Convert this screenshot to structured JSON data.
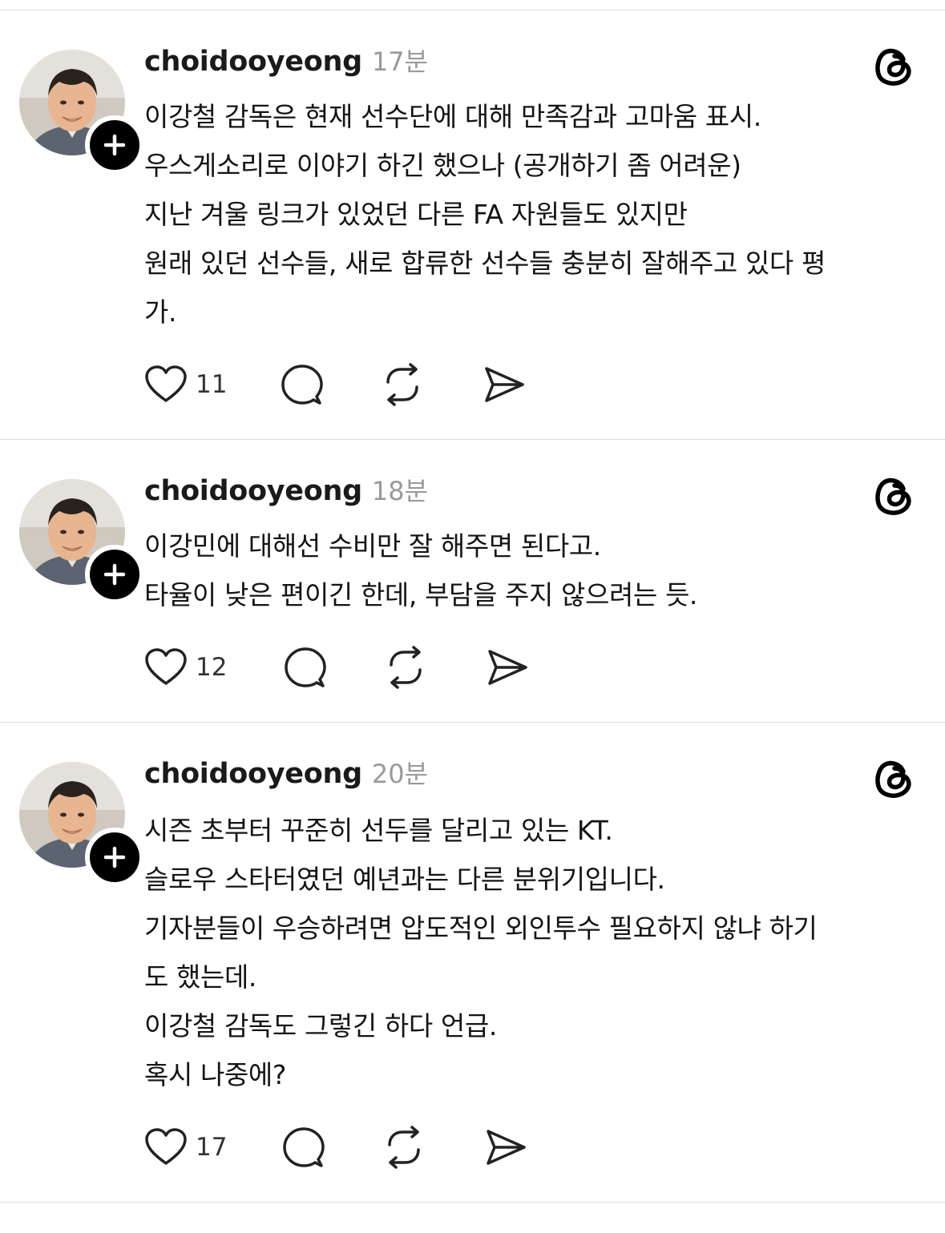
{
  "posts": [
    {
      "username": "choidooyeong",
      "time": "17분",
      "lines": [
        "이강철 감독은 현재 선수단에 대해 만족감과 고마움 표시.",
        "우스게소리로 이야기 하긴 했으나 (공개하기 좀 어려운)",
        "지난 겨울 링크가 있었던 다른 FA 자원들도 있지만",
        "원래 있던 선수들, 새로 합류한 선수들 충분히 잘해주고 있다 평",
        "가."
      ],
      "likes": "11"
    },
    {
      "username": "choidooyeong",
      "time": "18분",
      "lines": [
        "이강민에 대해선 수비만 잘 해주면 된다고.",
        "타율이 낮은 편이긴 한데, 부담을 주지 않으려는 듯."
      ],
      "likes": "12"
    },
    {
      "username": "choidooyeong",
      "time": "20분",
      "lines": [
        "시즌 초부터 꾸준히 선두를 달리고 있는 KT.",
        "슬로우 스타터였던 예년과는 다른 분위기입니다.",
        "기자분들이 우승하려면 압도적인 외인투수 필요하지 않냐 하기",
        "도 했는데.",
        "이강철 감독도 그렇긴 하다 언급.",
        "혹시 나중에?"
      ],
      "likes": "17"
    }
  ],
  "icons": {
    "like": "heart-icon",
    "reply": "speech-bubble-icon",
    "repost": "repost-arrows-icon",
    "share": "send-paper-plane-icon",
    "follow": "plus-icon",
    "brand": "threads-logo-icon"
  },
  "colors": {
    "text": "#141414",
    "muted": "#9a9a9a",
    "divider": "#dcdcdc",
    "badge": "#000000"
  }
}
